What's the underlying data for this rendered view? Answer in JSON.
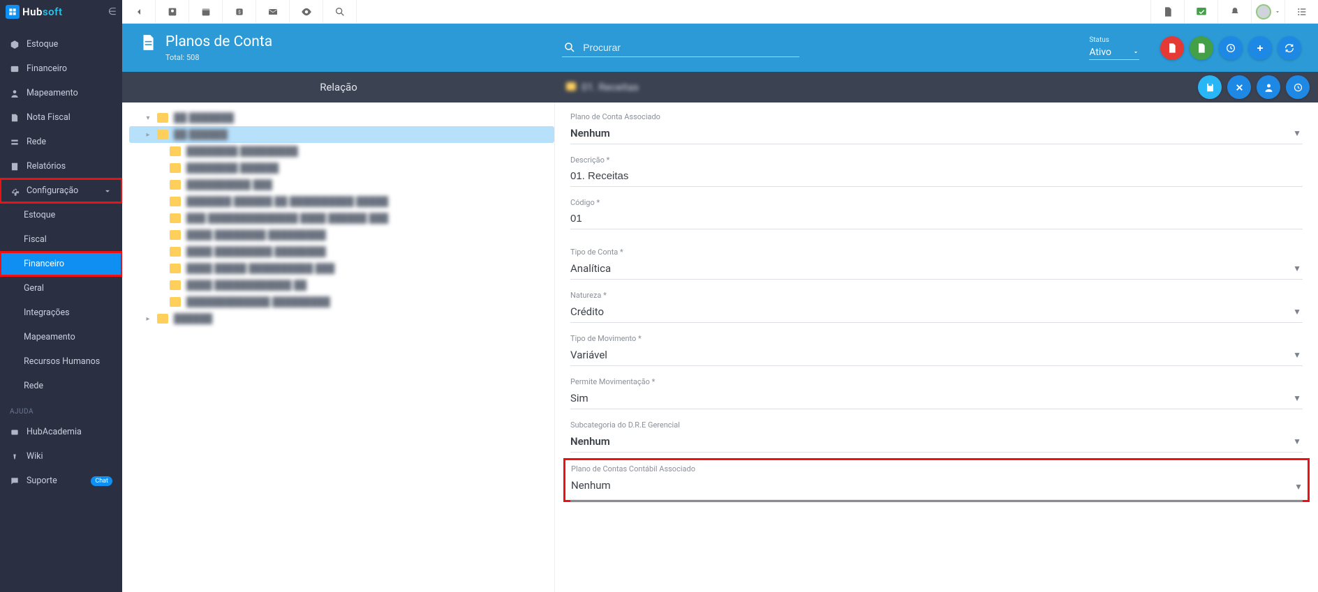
{
  "brand": {
    "hub": "Hub",
    "soft": "soft"
  },
  "sidebar": {
    "items": [
      {
        "label": "Estoque"
      },
      {
        "label": "Financeiro"
      },
      {
        "label": "Mapeamento"
      },
      {
        "label": "Nota Fiscal"
      },
      {
        "label": "Rede"
      },
      {
        "label": "Relatórios"
      }
    ],
    "config_label": "Configuração",
    "config_children": [
      {
        "label": "Estoque"
      },
      {
        "label": "Fiscal"
      },
      {
        "label": "Financeiro",
        "active": true
      },
      {
        "label": "Geral"
      },
      {
        "label": "Integrações"
      },
      {
        "label": "Mapeamento"
      },
      {
        "label": "Recursos Humanos"
      },
      {
        "label": "Rede"
      }
    ],
    "help_section": "AJUDA",
    "help_items": [
      {
        "label": "HubAcademia"
      },
      {
        "label": "Wiki"
      },
      {
        "label": "Suporte",
        "badge": "Chat"
      }
    ]
  },
  "header": {
    "title": "Planos de Conta",
    "subtitle": "Total: 508",
    "search_placeholder": "Procurar",
    "status_label": "Status",
    "status_value": "Ativo"
  },
  "subheader": {
    "left_title": "Relação",
    "right_title": "01. Receitas"
  },
  "form": {
    "plano_associado": {
      "label": "Plano de Conta Associado",
      "value": "Nenhum"
    },
    "descricao": {
      "label": "Descrição",
      "value": "01. Receitas"
    },
    "codigo": {
      "label": "Código",
      "value": "01"
    },
    "tipo_conta": {
      "label": "Tipo de Conta",
      "value": "Analítica"
    },
    "natureza": {
      "label": "Natureza",
      "value": "Crédito"
    },
    "tipo_movimento": {
      "label": "Tipo de Movimento",
      "value": "Variável"
    },
    "permite_mov": {
      "label": "Permite Movimentação",
      "value": "Sim"
    },
    "subcategoria": {
      "label": "Subcategoria do D.R.E Gerencial",
      "value": "Nenhum"
    },
    "contabil_assoc": {
      "label": "Plano de Contas Contábil Associado",
      "value": "Nenhum"
    }
  }
}
